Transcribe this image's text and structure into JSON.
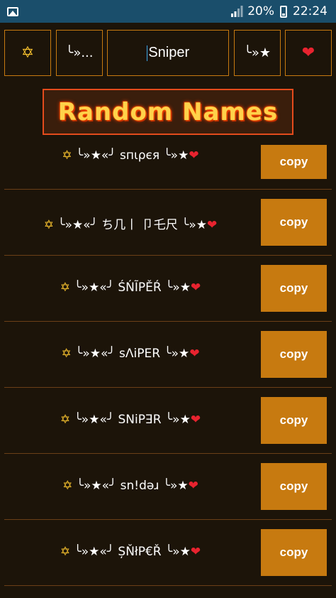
{
  "status_bar": {
    "battery": "20%",
    "time": "22:24"
  },
  "toolbar": {
    "prefix_symbol": "✡",
    "decor_left": "╰»...",
    "input_value": "Sniper",
    "decor_right": "╰»★",
    "suffix_symbol": "❤"
  },
  "banner": {
    "title": "Random Names"
  },
  "copy_label": "copy",
  "names": [
    {
      "prefix": "✡",
      "text": " ╰»★«╯ sпιρєя ╰»★",
      "suffix": "❤"
    },
    {
      "prefix": "✡",
      "text": " ╰»★«╯ ち几丨 卩乇尺 ╰»★",
      "suffix": "❤"
    },
    {
      "prefix": "✡",
      "text": " ╰»★«╯ ŚŃĨPĚŔ ╰»★",
      "suffix": "❤"
    },
    {
      "prefix": "✡",
      "text": " ╰»★«╯ ѕɅiPER ╰»★",
      "suffix": "❤"
    },
    {
      "prefix": "✡",
      "text": " ╰»★«╯ ꓢꓠiꓑꓱꓣ ╰»★",
      "suffix": "❤"
    },
    {
      "prefix": "✡",
      "text": " ╰»★«╯ sn!dǝɹ ╰»★",
      "suffix": "❤"
    },
    {
      "prefix": "✡",
      "text": " ╰»★«╯ ȘŇłP€Ř ╰»★",
      "suffix": "❤"
    }
  ]
}
